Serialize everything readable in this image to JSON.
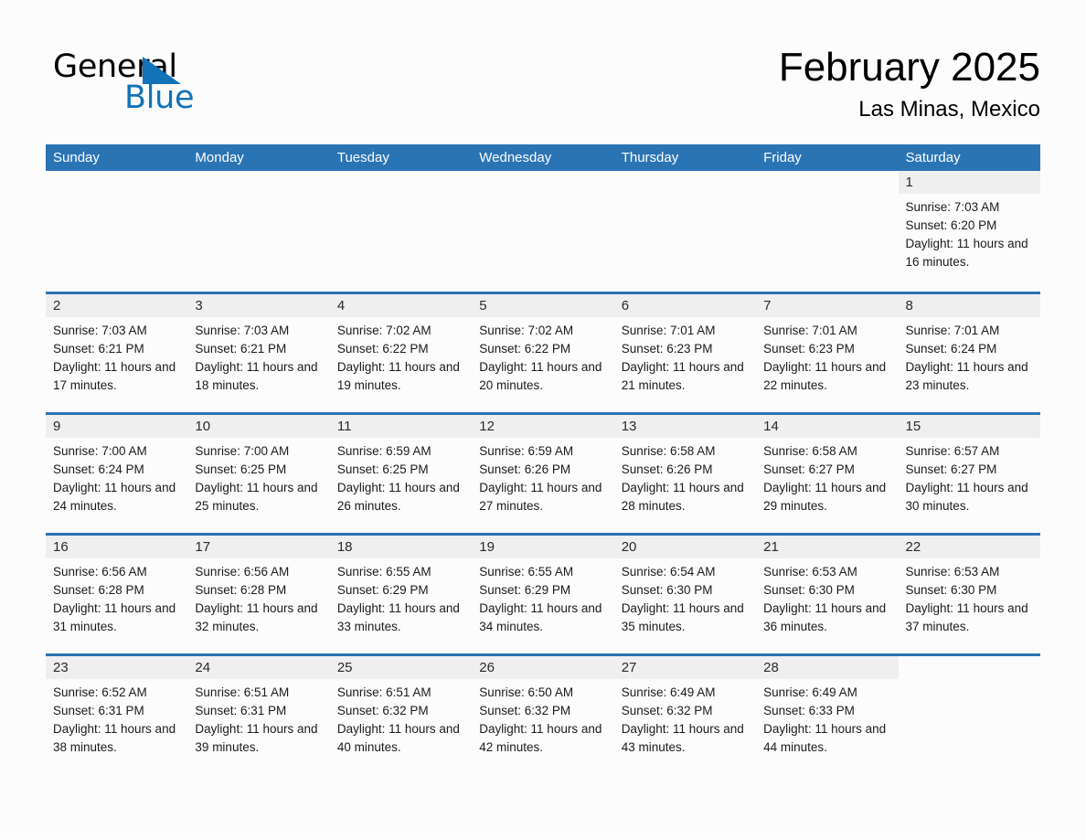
{
  "brand": {
    "name_top": "General",
    "name_bottom": "Blue",
    "triangle_color": "#1273b8"
  },
  "header": {
    "title": "February 2025",
    "subtitle": "Las Minas, Mexico"
  },
  "theme": {
    "header_blue": "#2b74b4",
    "band_gray": "#efefef",
    "page_bg": "#fcfcfc"
  },
  "calendar": {
    "day_headers": [
      "Sunday",
      "Monday",
      "Tuesday",
      "Wednesday",
      "Thursday",
      "Friday",
      "Saturday"
    ],
    "weeks": [
      [
        {
          "date": "",
          "blank": true
        },
        {
          "date": "",
          "blank": true
        },
        {
          "date": "",
          "blank": true
        },
        {
          "date": "",
          "blank": true
        },
        {
          "date": "",
          "blank": true
        },
        {
          "date": "",
          "blank": true
        },
        {
          "date": "1",
          "sunrise": "Sunrise: 7:03 AM",
          "sunset": "Sunset: 6:20 PM",
          "daylight": "Daylight: 11 hours and 16 minutes."
        }
      ],
      [
        {
          "date": "2",
          "sunrise": "Sunrise: 7:03 AM",
          "sunset": "Sunset: 6:21 PM",
          "daylight": "Daylight: 11 hours and 17 minutes."
        },
        {
          "date": "3",
          "sunrise": "Sunrise: 7:03 AM",
          "sunset": "Sunset: 6:21 PM",
          "daylight": "Daylight: 11 hours and 18 minutes."
        },
        {
          "date": "4",
          "sunrise": "Sunrise: 7:02 AM",
          "sunset": "Sunset: 6:22 PM",
          "daylight": "Daylight: 11 hours and 19 minutes."
        },
        {
          "date": "5",
          "sunrise": "Sunrise: 7:02 AM",
          "sunset": "Sunset: 6:22 PM",
          "daylight": "Daylight: 11 hours and 20 minutes."
        },
        {
          "date": "6",
          "sunrise": "Sunrise: 7:01 AM",
          "sunset": "Sunset: 6:23 PM",
          "daylight": "Daylight: 11 hours and 21 minutes."
        },
        {
          "date": "7",
          "sunrise": "Sunrise: 7:01 AM",
          "sunset": "Sunset: 6:23 PM",
          "daylight": "Daylight: 11 hours and 22 minutes."
        },
        {
          "date": "8",
          "sunrise": "Sunrise: 7:01 AM",
          "sunset": "Sunset: 6:24 PM",
          "daylight": "Daylight: 11 hours and 23 minutes."
        }
      ],
      [
        {
          "date": "9",
          "sunrise": "Sunrise: 7:00 AM",
          "sunset": "Sunset: 6:24 PM",
          "daylight": "Daylight: 11 hours and 24 minutes."
        },
        {
          "date": "10",
          "sunrise": "Sunrise: 7:00 AM",
          "sunset": "Sunset: 6:25 PM",
          "daylight": "Daylight: 11 hours and 25 minutes."
        },
        {
          "date": "11",
          "sunrise": "Sunrise: 6:59 AM",
          "sunset": "Sunset: 6:25 PM",
          "daylight": "Daylight: 11 hours and 26 minutes."
        },
        {
          "date": "12",
          "sunrise": "Sunrise: 6:59 AM",
          "sunset": "Sunset: 6:26 PM",
          "daylight": "Daylight: 11 hours and 27 minutes."
        },
        {
          "date": "13",
          "sunrise": "Sunrise: 6:58 AM",
          "sunset": "Sunset: 6:26 PM",
          "daylight": "Daylight: 11 hours and 28 minutes."
        },
        {
          "date": "14",
          "sunrise": "Sunrise: 6:58 AM",
          "sunset": "Sunset: 6:27 PM",
          "daylight": "Daylight: 11 hours and 29 minutes."
        },
        {
          "date": "15",
          "sunrise": "Sunrise: 6:57 AM",
          "sunset": "Sunset: 6:27 PM",
          "daylight": "Daylight: 11 hours and 30 minutes."
        }
      ],
      [
        {
          "date": "16",
          "sunrise": "Sunrise: 6:56 AM",
          "sunset": "Sunset: 6:28 PM",
          "daylight": "Daylight: 11 hours and 31 minutes."
        },
        {
          "date": "17",
          "sunrise": "Sunrise: 6:56 AM",
          "sunset": "Sunset: 6:28 PM",
          "daylight": "Daylight: 11 hours and 32 minutes."
        },
        {
          "date": "18",
          "sunrise": "Sunrise: 6:55 AM",
          "sunset": "Sunset: 6:29 PM",
          "daylight": "Daylight: 11 hours and 33 minutes."
        },
        {
          "date": "19",
          "sunrise": "Sunrise: 6:55 AM",
          "sunset": "Sunset: 6:29 PM",
          "daylight": "Daylight: 11 hours and 34 minutes."
        },
        {
          "date": "20",
          "sunrise": "Sunrise: 6:54 AM",
          "sunset": "Sunset: 6:30 PM",
          "daylight": "Daylight: 11 hours and 35 minutes."
        },
        {
          "date": "21",
          "sunrise": "Sunrise: 6:53 AM",
          "sunset": "Sunset: 6:30 PM",
          "daylight": "Daylight: 11 hours and 36 minutes."
        },
        {
          "date": "22",
          "sunrise": "Sunrise: 6:53 AM",
          "sunset": "Sunset: 6:30 PM",
          "daylight": "Daylight: 11 hours and 37 minutes."
        }
      ],
      [
        {
          "date": "23",
          "sunrise": "Sunrise: 6:52 AM",
          "sunset": "Sunset: 6:31 PM",
          "daylight": "Daylight: 11 hours and 38 minutes."
        },
        {
          "date": "24",
          "sunrise": "Sunrise: 6:51 AM",
          "sunset": "Sunset: 6:31 PM",
          "daylight": "Daylight: 11 hours and 39 minutes."
        },
        {
          "date": "25",
          "sunrise": "Sunrise: 6:51 AM",
          "sunset": "Sunset: 6:32 PM",
          "daylight": "Daylight: 11 hours and 40 minutes."
        },
        {
          "date": "26",
          "sunrise": "Sunrise: 6:50 AM",
          "sunset": "Sunset: 6:32 PM",
          "daylight": "Daylight: 11 hours and 42 minutes."
        },
        {
          "date": "27",
          "sunrise": "Sunrise: 6:49 AM",
          "sunset": "Sunset: 6:32 PM",
          "daylight": "Daylight: 11 hours and 43 minutes."
        },
        {
          "date": "28",
          "sunrise": "Sunrise: 6:49 AM",
          "sunset": "Sunset: 6:33 PM",
          "daylight": "Daylight: 11 hours and 44 minutes."
        },
        {
          "date": "",
          "blank": true
        }
      ]
    ]
  }
}
